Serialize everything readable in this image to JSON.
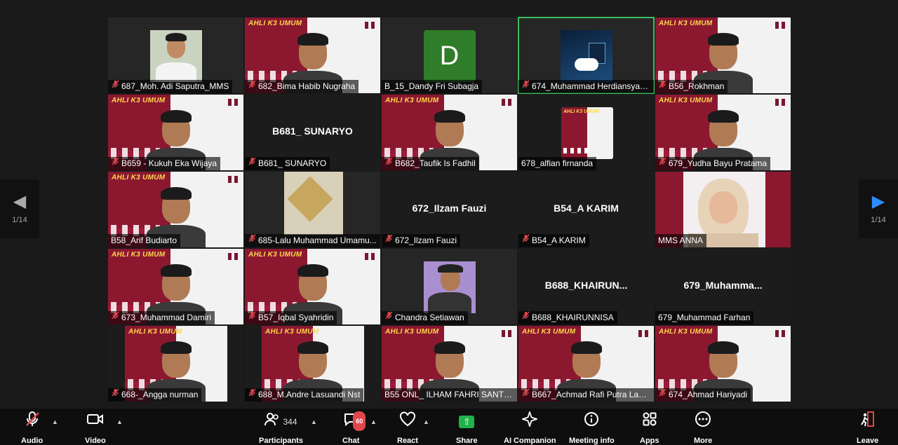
{
  "brand_banner": "AHLI K3 UMUM",
  "participants": [
    {
      "name": "687_Moh. Adi Saputra_MMS",
      "style": "photo-light",
      "muted": true
    },
    {
      "name": "682_Bima Habib Nugraha",
      "style": "brand",
      "muted": true
    },
    {
      "name": "B_15_Dandy Fri Subagja",
      "style": "avatar",
      "avatar_letter": "D",
      "muted": false
    },
    {
      "name": "674_Muhammad Herdiansyah...",
      "style": "photo-dark",
      "muted": true,
      "active": true
    },
    {
      "name": "B56_Rokhman",
      "style": "brand",
      "muted": true
    },
    {
      "name": "B659 - Kukuh Eka Wijaya",
      "style": "brand",
      "muted": true
    },
    {
      "name": "B681_ SUNARYO",
      "style": "name",
      "display_name": "B681_ SUNARYO",
      "muted": true
    },
    {
      "name": "B682_Taufik Is Fadhil",
      "style": "brand",
      "muted": true
    },
    {
      "name": "678_alfian firnanda",
      "style": "brand-small",
      "muted": false
    },
    {
      "name": "679_Yudha Bayu Pratama",
      "style": "brand",
      "muted": true
    },
    {
      "name": "B58_Arif Budiarto",
      "style": "brand",
      "muted": false
    },
    {
      "name": "685-Lalu Muhammad Umamu...",
      "style": "photo-ceiling",
      "muted": true
    },
    {
      "name": "672_Ilzam Fauzi",
      "style": "name",
      "display_name": "672_Ilzam Fauzi",
      "muted": true
    },
    {
      "name": "B54_A KARIM",
      "style": "name",
      "display_name": "B54_A KARIM",
      "muted": true
    },
    {
      "name": "MMS ANNA",
      "style": "photo-anna",
      "muted": false
    },
    {
      "name": "673_Muhammad Damiri",
      "style": "brand",
      "muted": true
    },
    {
      "name": "B57_Iqbal Syahridin",
      "style": "brand",
      "muted": true
    },
    {
      "name": "Chandra Setiawan",
      "style": "photo-chandra",
      "muted": true
    },
    {
      "name": "B688_KHAIRUNNISA",
      "style": "name",
      "display_name": "B688_KHAIRUN...",
      "muted": true
    },
    {
      "name": "679_Muhammad Farhan",
      "style": "name",
      "display_name": "679_Muhamma...",
      "muted": false
    },
    {
      "name": "668-_Angga nurman",
      "style": "brand-narrow",
      "muted": true
    },
    {
      "name": "688_M.Andre Lasuandi Nst",
      "style": "brand-narrow",
      "muted": true
    },
    {
      "name": "B55 ONL_ ILHAM FAHRI SANTIAR...",
      "style": "brand",
      "muted": false
    },
    {
      "name": "B667_Achmad Rafi Putra Lasa...",
      "style": "brand",
      "muted": true
    },
    {
      "name": "674_Ahmad Hariyadi",
      "style": "brand",
      "muted": true
    }
  ],
  "pager": {
    "left": "1/14",
    "right": "1/14"
  },
  "toolbar": {
    "audio": "Audio",
    "video": "Video",
    "participants": "Participants",
    "participants_count": "344",
    "chat": "Chat",
    "chat_badge": "60",
    "react": "React",
    "share": "Share",
    "ai_companion": "AI Companion",
    "meeting_info": "Meeting info",
    "apps": "Apps",
    "more": "More",
    "leave": "Leave"
  },
  "colors": {
    "brand_red": "#8c1830",
    "active_border": "#3fbf5f",
    "mute_red": "#e0474c",
    "share_green": "#1fb24a",
    "nav_arrow_blue": "#2d8cff"
  }
}
